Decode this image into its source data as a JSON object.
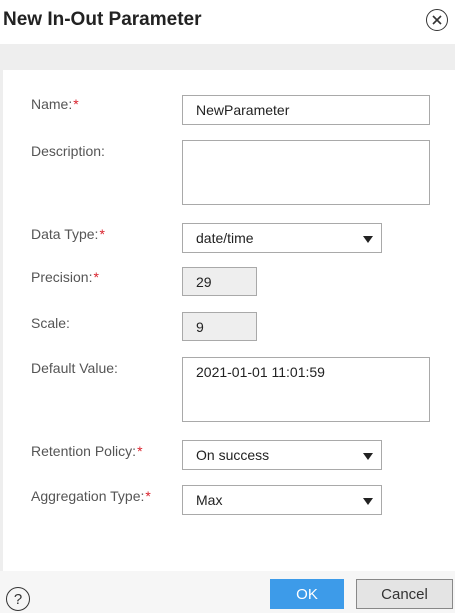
{
  "dialog": {
    "title": "New In-Out Parameter",
    "close_icon": "close-circle-icon",
    "help_icon": "help-circle-icon",
    "help_glyph": "?"
  },
  "required_marker": "*",
  "form": {
    "name": {
      "label": "Name:",
      "required": true,
      "value": "NewParameter"
    },
    "description": {
      "label": "Description:",
      "required": false,
      "value": ""
    },
    "data_type": {
      "label": "Data Type:",
      "required": true,
      "value": "date/time"
    },
    "precision": {
      "label": "Precision:",
      "required": true,
      "value": "29"
    },
    "scale": {
      "label": "Scale:",
      "required": false,
      "value": "9"
    },
    "default_value": {
      "label": "Default Value:",
      "required": false,
      "value": "2021-01-01 11:01:59"
    },
    "retention_policy": {
      "label": "Retention Policy:",
      "required": true,
      "value": "On success"
    },
    "aggregation_type": {
      "label": "Aggregation Type:",
      "required": true,
      "value": "Max"
    }
  },
  "footer": {
    "ok_label": "OK",
    "cancel_label": "Cancel"
  },
  "colors": {
    "required": "#d9212c",
    "primary_button": "#3d9be9",
    "body_background": "#eeeeee"
  }
}
